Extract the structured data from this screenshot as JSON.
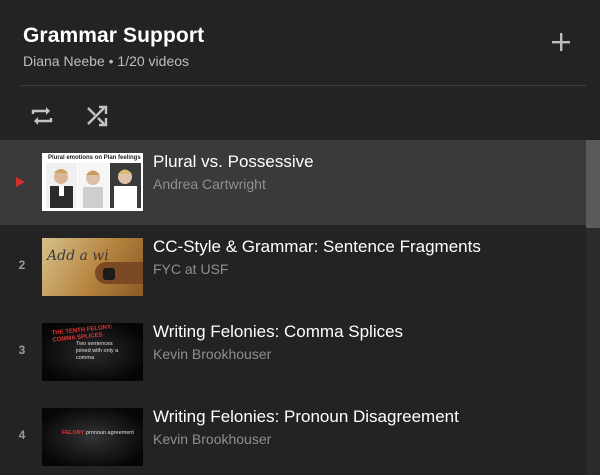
{
  "playlist": {
    "title": "Grammar Support",
    "meta": "Diana Neebe • 1/20 videos"
  },
  "controls": {
    "add_icon": "plus-icon",
    "loop_icon": "loop-icon",
    "shuffle_icon": "shuffle-icon"
  },
  "colors": {
    "background": "#232323",
    "active_row": "#3a3a3a",
    "now_playing_marker": "#d32f2f",
    "author_text": "#8f8f8f"
  },
  "videos": [
    {
      "index": "",
      "now_playing": true,
      "title": "Plural vs. Possessive",
      "author": "Andrea Cartwright",
      "thumb_caption": "Plural   emotions on   Plan feelings"
    },
    {
      "index": "2",
      "now_playing": false,
      "title": "CC-Style & Grammar: Sentence Fragments",
      "author": "FYC at USF",
      "thumb_caption": "Add a wi"
    },
    {
      "index": "3",
      "now_playing": false,
      "title": "Writing Felonies: Comma Splices",
      "author": "Kevin Brookhouser",
      "thumb_caption_red": "THE TENTH FELONY: COMMA SPLICES",
      "thumb_caption": "Two sentences joined with only a comma"
    },
    {
      "index": "4",
      "now_playing": false,
      "title": "Writing Felonies: Pronoun Disagreement",
      "author": "Kevin Brookhouser",
      "thumb_caption_red": "FELONY",
      "thumb_caption": "pronoun agreement"
    }
  ]
}
